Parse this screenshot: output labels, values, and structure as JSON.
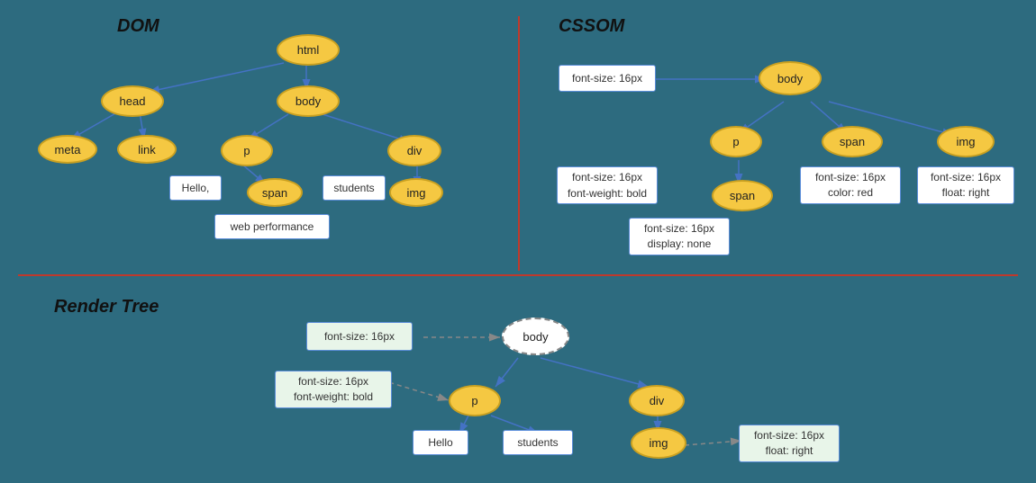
{
  "sections": {
    "dom": {
      "title": "DOM",
      "nodes": {
        "html": "html",
        "head": "head",
        "body": "body",
        "meta": "meta",
        "link": "link",
        "p": "p",
        "span_dom": "span",
        "div_dom": "div",
        "img_dom": "img"
      },
      "textboxes": {
        "hello": "Hello,",
        "students": "students",
        "web_performance": "web performance"
      }
    },
    "cssom": {
      "title": "CSSOM",
      "nodes": {
        "body": "body",
        "p": "p",
        "span_cssom": "span",
        "img_cssom": "img",
        "span_inner": "span"
      },
      "textboxes": {
        "font_size_body": "font-size: 16px",
        "font_size_p": "font-size: 16px\nfont-weight: bold",
        "font_size_span": "font-size: 16px\ncolor: red",
        "font_size_img": "font-size: 16px\nfloat: right",
        "font_size_span_inner": "font-size: 16px\ndisplay: none"
      }
    },
    "render_tree": {
      "title": "Render Tree",
      "nodes": {
        "body": "body",
        "p": "p",
        "div": "div",
        "img": "img"
      },
      "textboxes": {
        "font_size_body": "font-size: 16px",
        "font_size_p": "font-size: 16px\nfont-weight: bold",
        "font_size_img": "font-size: 16px\nfloat: right",
        "hello": "Hello",
        "students": "students"
      }
    }
  }
}
